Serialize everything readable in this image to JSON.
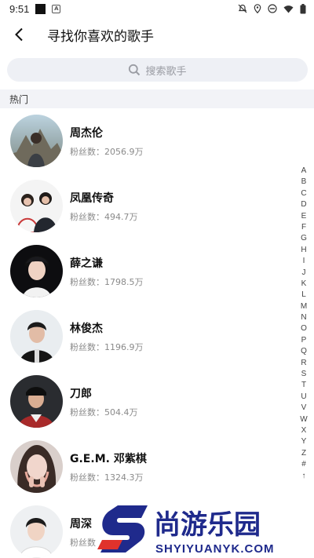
{
  "status_bar": {
    "time": "9:51"
  },
  "header": {
    "title": "寻找你喜欢的歌手"
  },
  "search": {
    "placeholder": "搜索歌手"
  },
  "section": {
    "title": "热门"
  },
  "singers": [
    {
      "name": "周杰伦",
      "fans": "粉丝数：2056.9万"
    },
    {
      "name": "凤凰传奇",
      "fans": "粉丝数：494.7万"
    },
    {
      "name": "薛之谦",
      "fans": "粉丝数：1798.5万"
    },
    {
      "name": "林俊杰",
      "fans": "粉丝数：1196.9万"
    },
    {
      "name": "刀郎",
      "fans": "粉丝数：504.4万"
    },
    {
      "name": "G.E.M. 邓紫棋",
      "fans": "粉丝数：1324.3万"
    },
    {
      "name": "周深",
      "fans": "粉丝数"
    }
  ],
  "index_letters": [
    "A",
    "B",
    "C",
    "D",
    "E",
    "F",
    "G",
    "H",
    "I",
    "J",
    "K",
    "L",
    "M",
    "N",
    "O",
    "P",
    "Q",
    "R",
    "S",
    "T",
    "U",
    "V",
    "W",
    "X",
    "Y",
    "Z",
    "#",
    "↑"
  ],
  "watermark": {
    "brand": "尚游乐园",
    "url": "SHYIYUANYK.COM"
  },
  "colors": {
    "search_bg": "#eef0f5",
    "section_bg": "#f2f3f7",
    "watermark_blue": "#1f2a8c",
    "watermark_red": "#e0322c"
  }
}
